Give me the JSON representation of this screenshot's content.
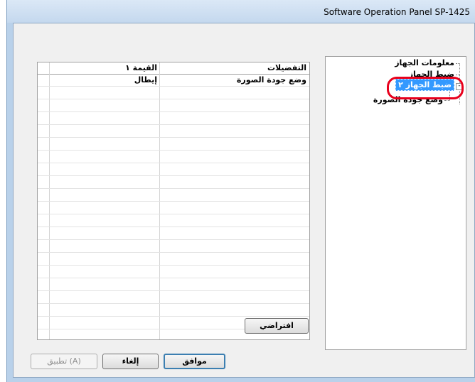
{
  "window": {
    "title": "Software Operation Panel SP-1425"
  },
  "tree": {
    "items": [
      {
        "label": "معلومات الجهاز"
      },
      {
        "label": "ضبط الجهاز"
      },
      {
        "label": "ضبط الجهاز ٢",
        "selected": true,
        "expander": "-"
      },
      {
        "label": "وضع جودة الصورة"
      }
    ]
  },
  "grid": {
    "columns": [
      "التفضيلات",
      "القيمة ١"
    ],
    "rows": [
      {
        "setting": "وضع جودة الصورة",
        "value": "إيطال"
      }
    ]
  },
  "buttons": {
    "default": "افتراضي",
    "ok": "موافق",
    "cancel": "إلغاء",
    "apply": "تطبيق (A)"
  },
  "colors": {
    "selection": "#3399ff",
    "highlight_ring": "#e8001c",
    "window_frame": "#b9d1ea"
  }
}
